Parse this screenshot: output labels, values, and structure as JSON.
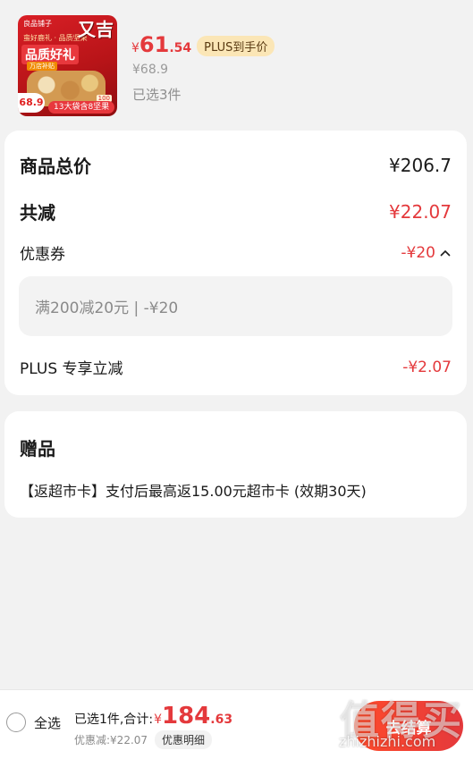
{
  "product": {
    "thumbnail": {
      "brand_text": "良品铺子",
      "line1": "蛮好鹿礼 · 品质坚果",
      "headline": "品质好礼",
      "tag": "万店补贴",
      "calligraphy": "又吉",
      "price": "68.9",
      "badge": "100",
      "bottom_text": "13大袋含8坚果"
    },
    "price_symbol": "¥",
    "price_int": "61",
    "price_dec": ".54",
    "plus_tag": "PLUS到手价",
    "original_price": "¥68.9",
    "selected": "已选3件"
  },
  "summary": {
    "total_label": "商品总价",
    "total_value": "¥206.7",
    "reduce_label": "共减",
    "reduce_value": "¥22.07",
    "coupon_label": "优惠券",
    "coupon_value": "-¥20",
    "coupon_detail": "满200减20元 | -¥20",
    "plus_label": "PLUS 专享立减",
    "plus_value": "-¥2.07"
  },
  "gift": {
    "title": "赠品",
    "text": "【返超市卡】支付后最高返15.00元超市卡 (效期30天)"
  },
  "bottom_bar": {
    "select_all": "全选",
    "sum_label": "已选1件,合计:",
    "sum_symbol": "¥",
    "sum_int": "184",
    "sum_dec": ".63",
    "discount_text": "优惠减:¥22.07",
    "detail_button": "优惠明细",
    "checkout_button": "去结算"
  },
  "watermark": {
    "cn": "值得买",
    "url": "zhizhizhi.com"
  },
  "colors": {
    "accent_red": "#e4393c",
    "plus_gold": "#fbe6b6",
    "background": "#f2f2f2"
  }
}
